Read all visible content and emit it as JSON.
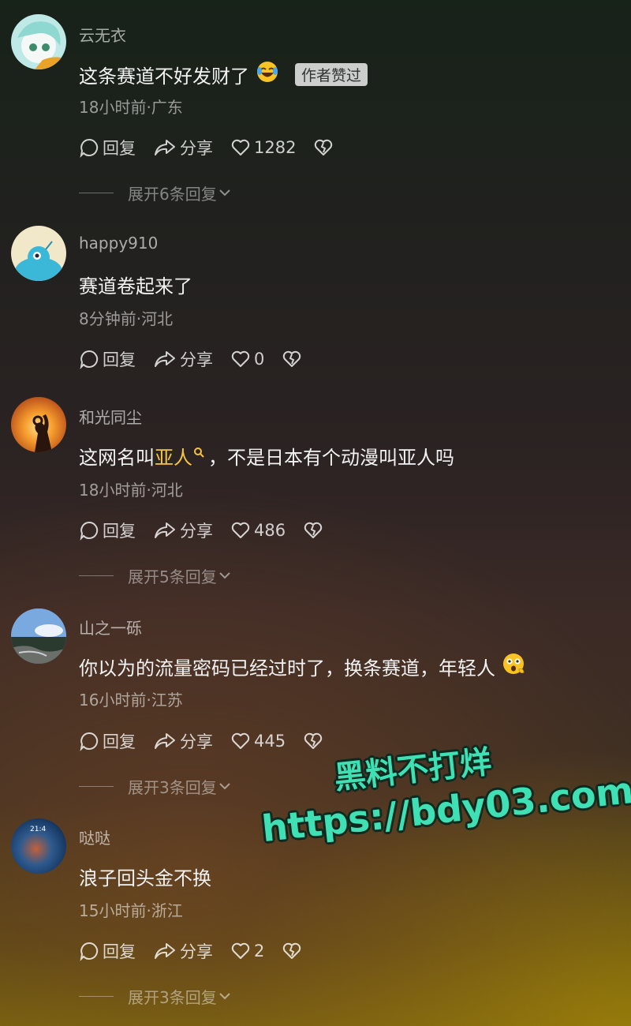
{
  "comments": [
    {
      "username": "云无衣",
      "text": "这条赛道不好发财了",
      "badge": "作者赞过",
      "meta": "18小时前·广东",
      "reply": "回复",
      "share": "分享",
      "likes": "1282",
      "expand": "展开6条回复"
    },
    {
      "username": "happy910",
      "text": "赛道卷起来了",
      "meta": "8分钟前·河北",
      "reply": "回复",
      "share": "分享",
      "likes": "0"
    },
    {
      "username": "和光同尘",
      "text_before": "这网名叫",
      "text_highlight": "亚人",
      "text_after": "，不是日本有个动漫叫亚人吗",
      "meta": "18小时前·河北",
      "reply": "回复",
      "share": "分享",
      "likes": "486",
      "expand": "展开5条回复"
    },
    {
      "username": "山之一砾",
      "text": "你以为的流量密码已经过时了，换条赛道，年轻人",
      "meta": "16小时前·江苏",
      "reply": "回复",
      "share": "分享",
      "likes": "445",
      "expand": "展开3条回复"
    },
    {
      "username": "哒哒",
      "avatar_text": "21:4",
      "text": "浪子回头金不换",
      "meta": "15小时前·浙江",
      "reply": "回复",
      "share": "分享",
      "likes": "2",
      "expand": "展开3条回复"
    }
  ],
  "watermark": {
    "line1": "黑料不打烊",
    "line2": "https://bdy03.com"
  },
  "colors": {
    "highlight": "#f6c343",
    "watermark": "#3fe0b4"
  }
}
